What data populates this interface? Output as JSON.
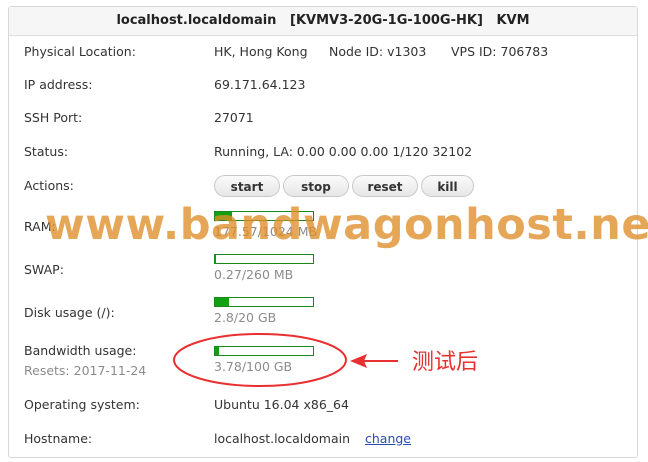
{
  "header": {
    "hostname": "localhost.localdomain",
    "plan": "[KVMV3-20G-1G-100G-HK]",
    "virt": "KVM"
  },
  "rows": {
    "location": {
      "label": "Physical Location:",
      "value": "HK, Hong Kong",
      "node_id": "Node ID: v1303",
      "vps_id": "VPS ID: 706783"
    },
    "ip": {
      "label": "IP address:",
      "value": "69.171.64.123"
    },
    "ssh": {
      "label": "SSH Port:",
      "value": "27071"
    },
    "status": {
      "label": "Status:",
      "value": "Running, LA: 0.00 0.00 0.00 1/120 32102"
    },
    "actions": {
      "label": "Actions:",
      "buttons": [
        "start",
        "stop",
        "reset",
        "kill"
      ]
    },
    "ram": {
      "label": "RAM:",
      "usage": "177.57/1024 MB",
      "fraction": 0.173
    },
    "swap": {
      "label": "SWAP:",
      "usage": "0.27/260 MB",
      "fraction": 0.001
    },
    "disk": {
      "label": "Disk usage (/):",
      "usage": "2.8/20 GB",
      "fraction": 0.14
    },
    "bandwidth": {
      "label": "Bandwidth usage:",
      "resets": "Resets: 2017-11-24",
      "usage": "3.78/100 GB",
      "fraction": 0.0378
    },
    "os": {
      "label": "Operating system:",
      "value": "Ubuntu 16.04 x86_64"
    },
    "hostname": {
      "label": "Hostname:",
      "value": "localhost.localdomain",
      "link": "change"
    }
  },
  "watermark": "www.bandwagonhost.net",
  "annotation": {
    "text": "测试后"
  },
  "colors": {
    "bar_fill": "#12a012",
    "bar_border": "#1a8a1a",
    "watermark": "#de8e28",
    "annotation": "#e83030",
    "link": "#2a4bb0"
  }
}
